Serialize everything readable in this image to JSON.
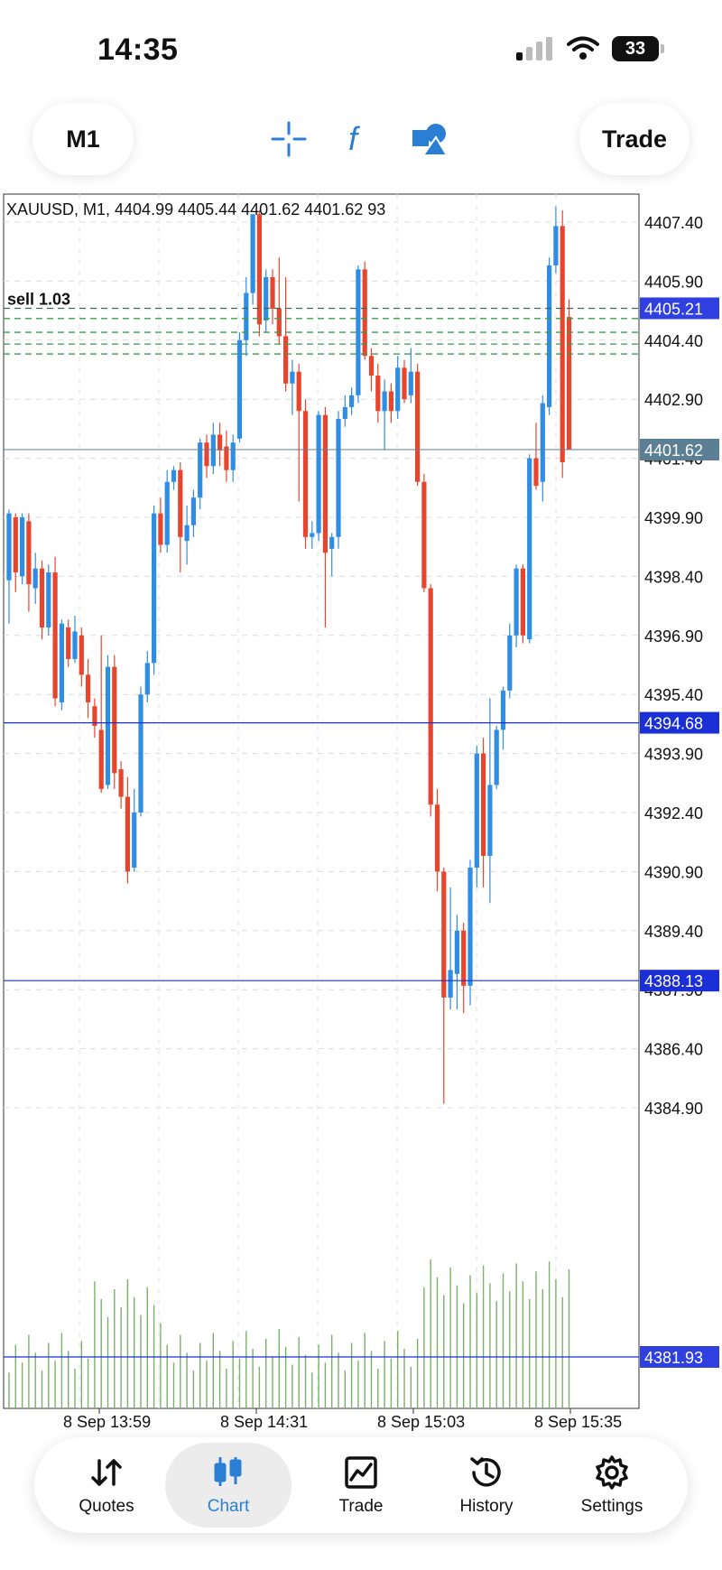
{
  "status_bar": {
    "time": "14:35",
    "battery": "33"
  },
  "toolbar": {
    "timeframe": "M1",
    "trade_label": "Trade",
    "icons": [
      "crosshair-icon",
      "indicators-f-icon",
      "objects-shapes-icon"
    ]
  },
  "chart_header": "XAUUSD, M1, 4404.99 4405.44 4401.62 4401.62 93",
  "price_axis": [
    "4407.40",
    "4405.90",
    "4404.40",
    "4402.90",
    "4401.40",
    "4399.90",
    "4398.40",
    "4396.90",
    "4395.40",
    "4393.90",
    "4392.40",
    "4390.90",
    "4389.40",
    "4387.90",
    "4386.40",
    "4384.90"
  ],
  "time_axis": [
    "8 Sep 13:59",
    "8 Sep 14:31",
    "8 Sep 15:03",
    "8 Sep 15:35"
  ],
  "trade_label": "sell 1.03",
  "lines": {
    "sl_label": "4405.21",
    "bid_label": "4401.62",
    "level1_label": "4394.68",
    "level2_label": "4388.13",
    "vol_label": "4381.93"
  },
  "colors": {
    "bull": "#2f8de4",
    "bear": "#e8452f",
    "level": "#1a2fd6",
    "bid": "#5c7f94",
    "volume": "#7bb06a"
  },
  "bottom_nav": [
    {
      "label": "Quotes",
      "icon": "quotes-arrows-icon",
      "active": false
    },
    {
      "label": "Chart",
      "icon": "chart-candles-icon",
      "active": true
    },
    {
      "label": "Trade",
      "icon": "trade-line-chart-icon",
      "active": false
    },
    {
      "label": "History",
      "icon": "history-clock-icon",
      "active": false
    },
    {
      "label": "Settings",
      "icon": "settings-gear-icon",
      "active": false
    }
  ]
}
